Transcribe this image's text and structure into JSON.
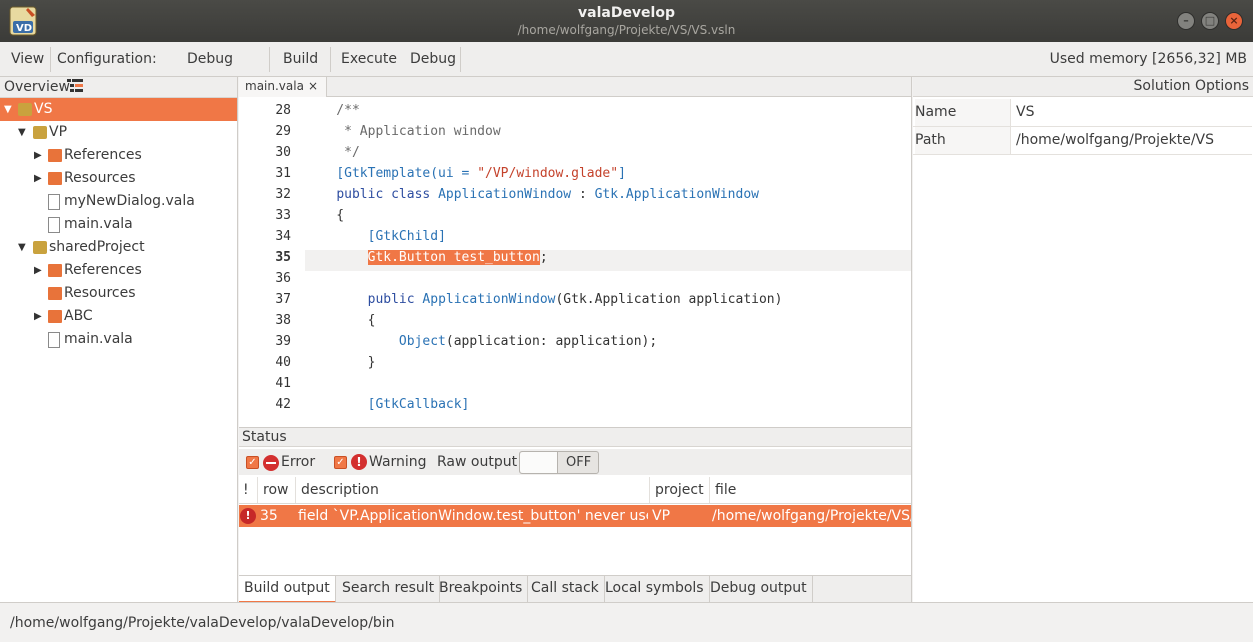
{
  "window": {
    "title": "valaDevelop",
    "subtitle": "/home/wolfgang/Projekte/VS/VS.vsln",
    "logo_letters": "VD"
  },
  "toolbar": {
    "view": "View",
    "configuration_label": "Configuration:",
    "configuration_value": "Debug",
    "build": "Build",
    "execute": "Execute",
    "debug": "Debug",
    "memory": "Used memory [2656,32] MB"
  },
  "overview": {
    "title": "Overview",
    "tree": [
      {
        "label": "VS",
        "icon": "solution-icon",
        "expanded": true,
        "selected": true
      },
      {
        "label": "VP",
        "icon": "project-icon",
        "expanded": true
      },
      {
        "label": "References",
        "icon": "folder-icon"
      },
      {
        "label": "Resources",
        "icon": "folder-icon"
      },
      {
        "label": "myNewDialog.vala",
        "icon": "file-icon"
      },
      {
        "label": "main.vala",
        "icon": "file-icon"
      },
      {
        "label": "sharedProject",
        "icon": "project-icon",
        "expanded": true
      },
      {
        "label": "References",
        "icon": "folder-icon"
      },
      {
        "label": "Resources",
        "icon": "folder-icon"
      },
      {
        "label": "ABC",
        "icon": "folder-icon"
      },
      {
        "label": "main.vala",
        "icon": "file-icon"
      }
    ]
  },
  "editor": {
    "tab_label": "main.vala",
    "tab_close": "×",
    "current_line": 35,
    "line_numbers": [
      "28",
      "29",
      "30",
      "31",
      "32",
      "33",
      "34",
      "35",
      "36",
      "37",
      "38",
      "39",
      "40",
      "41",
      "42"
    ]
  },
  "status": {
    "title": "Status",
    "filter_error": "Error",
    "filter_warning": "Warning",
    "raw_output_label": "Raw output",
    "raw_output_state": "OFF",
    "columns": [
      "!",
      "row",
      "description",
      "project",
      "file"
    ],
    "rows": [
      {
        "row": "35",
        "description": "field `VP.ApplicationWindow.test_button' never used",
        "project": "VP",
        "file": "/home/wolfgang/Projekte/VS/V"
      }
    ],
    "tabs": [
      "Build output",
      "Search result",
      "Breakpoints",
      "Call stack",
      "Local symbols",
      "Debug output"
    ]
  },
  "solution_options": {
    "title": "Solution Options",
    "name_label": "Name",
    "name_value": "VS",
    "path_label": "Path",
    "path_value": "/home/wolfgang/Projekte/VS"
  },
  "statusbar": {
    "path": "/home/wolfgang/Projekte/valaDevelop/valaDevelop/bin"
  },
  "colors": {
    "accent": "#f07746",
    "titlebar": "#3b3b38"
  }
}
